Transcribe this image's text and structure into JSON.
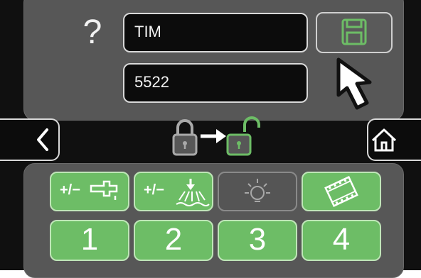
{
  "help": {
    "glyph": "?"
  },
  "fields": {
    "name_value": "TIM",
    "code_value": "5522"
  },
  "icons": {
    "help": "question-mark-icon",
    "save": "floppy-disk-icon",
    "back": "chevron-left-icon",
    "home": "home-icon",
    "unlock": "lock-to-unlock-icon",
    "water": "water-tap-plus-minus-icon",
    "spray": "sprinkler-plus-minus-icon",
    "light": "light-bulb-icon",
    "video": "film-icon",
    "cursor": "mouse-pointer-icon"
  },
  "presets": [
    "1",
    "2",
    "3",
    "4"
  ],
  "colors": {
    "accent_green": "#6dbd66",
    "panel_gray": "#575757",
    "screen_black": "#101010"
  }
}
